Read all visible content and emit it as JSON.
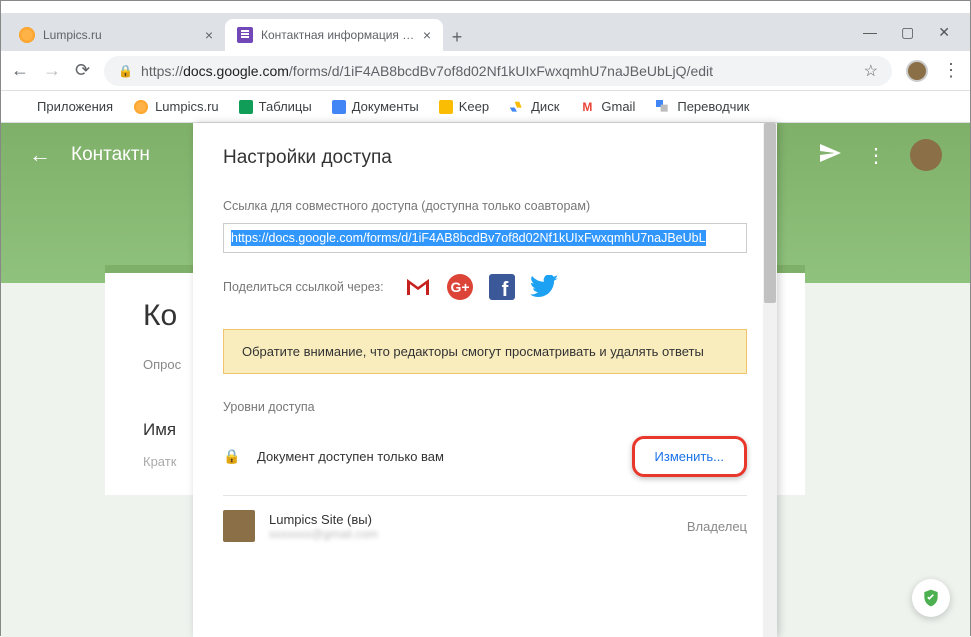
{
  "tabs": [
    {
      "title": "Lumpics.ru"
    },
    {
      "title": "Контактная информация - Goo..."
    }
  ],
  "url": {
    "scheme": "https://",
    "host": "docs.google.com",
    "path": "/forms/d/1iF4AB8bcdBv7of8d02Nf1kUIxFwxqmhU7naJBeUbLjQ/edit"
  },
  "bookmarks": {
    "apps": "Приложения",
    "items": [
      "Lumpics.ru",
      "Таблицы",
      "Документы",
      "Keep",
      "Диск",
      "Gmail",
      "Переводчик"
    ]
  },
  "app_header": {
    "title": "Контактн"
  },
  "card": {
    "title_prefix": "Ко",
    "survey_label": "Опрос",
    "field_label": "Имя",
    "field_hint": "Кратк"
  },
  "modal": {
    "title": "Настройки доступа",
    "link_label": "Ссылка для совместного доступа (доступна только соавторам)",
    "link_value": "https://docs.google.com/forms/d/1iF4AB8bcdBv7of8d02Nf1kUIxFwxqmhU7naJBeUbL",
    "share_via": "Поделиться ссылкой через:",
    "warning": "Обратите внимание, что редакторы смогут просматривать и удалять ответы",
    "access_levels": "Уровни доступа",
    "private_text": "Документ доступен только вам",
    "change_btn": "Изменить...",
    "user": {
      "name": "Lumpics Site (вы)",
      "email_suffix": "@gmail.com",
      "role": "Владелец"
    }
  }
}
